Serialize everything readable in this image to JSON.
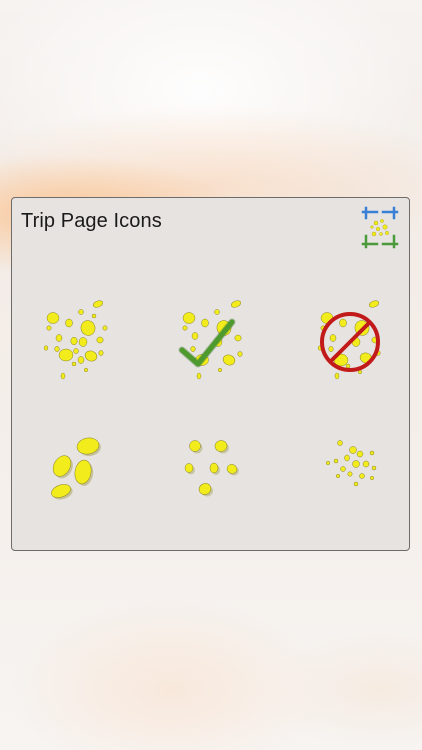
{
  "panel": {
    "title": "Trip Page Icons"
  },
  "icons": [
    {
      "name": "footprints-scattered-icon"
    },
    {
      "name": "footprints-checked-icon"
    },
    {
      "name": "footprints-prohibited-icon"
    },
    {
      "name": "footprints-large-icon"
    },
    {
      "name": "footprints-medium-icon"
    },
    {
      "name": "footprints-small-icon"
    }
  ],
  "colors": {
    "footprint": "#f2ec1c",
    "footprint_shadow": "#8a8420",
    "check": "#4f9a2e",
    "prohibit": "#c21a1a",
    "crop_blue": "#3a7fd6",
    "crop_green": "#4b9a3b",
    "panel_bg": "#e6e3e0",
    "panel_border": "#6e6c6a"
  }
}
